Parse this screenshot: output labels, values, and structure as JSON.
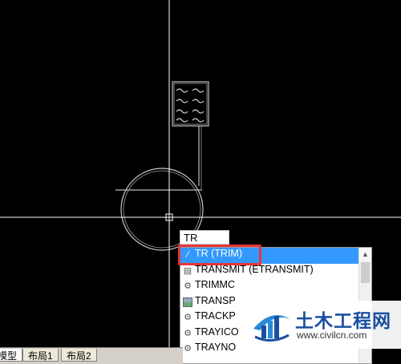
{
  "command_line": {
    "typed": "TR"
  },
  "autocomplete": {
    "items": [
      {
        "label": "TR (TRIM)",
        "icon": "trim-icon",
        "selected": true
      },
      {
        "label": "TRANSMIT (ETRANSMIT)",
        "icon": "file-icon"
      },
      {
        "label": "TRIMMC",
        "icon": "gear-icon"
      },
      {
        "label": "TRANSP",
        "icon": "image-icon"
      },
      {
        "label": "TRACKP",
        "icon": "gear-icon"
      },
      {
        "label": "TRAYICO",
        "icon": "gear-icon"
      },
      {
        "label": "TRAYNO",
        "icon": "gear-icon"
      }
    ],
    "scroll_up_icon": "scroll-up-arrow-icon"
  },
  "layout_tabs": [
    {
      "label": "模型",
      "active": true
    },
    {
      "label": "布局1"
    },
    {
      "label": "布局2"
    }
  ],
  "watermark": {
    "name": "土木工程网",
    "url": "www.civilcn.com",
    "colors": {
      "text": "#1a4fa0",
      "accent": "#2a88d8"
    }
  },
  "colors": {
    "canvas_background": "#000000",
    "crosshair": "#ffffff",
    "drawing_lines": "#c8c8c8",
    "selection": "#3399ff",
    "highlight_border": "#e8343a"
  }
}
